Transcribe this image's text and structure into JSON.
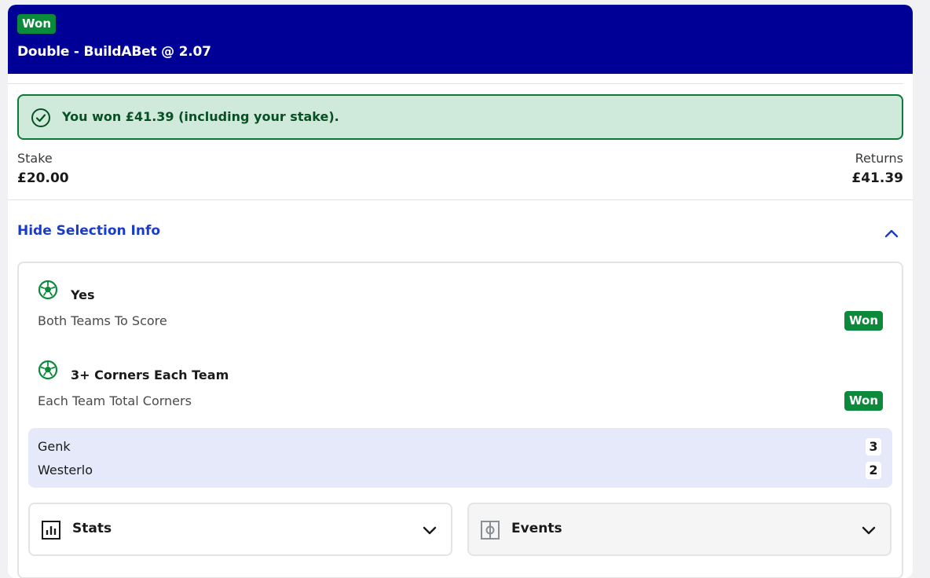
{
  "header": {
    "status_badge": "Won",
    "bet_title": "Double - BuildABet @ 2.07",
    "bg_color": "#000096"
  },
  "win_banner": {
    "icon": "check-circle-icon",
    "text": "You won £41.39 (including your stake)."
  },
  "summary": {
    "stake_label": "Stake",
    "stake_value": "£20.00",
    "returns_label": "Returns",
    "returns_value": "£41.39"
  },
  "selection_toggle": {
    "label": "Hide Selection Info",
    "icon": "chevron-up-icon"
  },
  "selections": [
    {
      "icon": "football-icon",
      "name": "Yes",
      "market": "Both Teams To Score",
      "status": "Won"
    },
    {
      "icon": "football-icon",
      "name": "3+ Corners Each Team",
      "market": "Each Team Total Corners",
      "status": "Won"
    }
  ],
  "scores": [
    {
      "team": "Genk",
      "value": "3"
    },
    {
      "team": "Westerlo",
      "value": "2"
    }
  ],
  "dropdowns": {
    "stats": {
      "label": "Stats",
      "icon": "bar-chart-icon"
    },
    "events": {
      "label": "Events",
      "icon": "pitch-icon"
    }
  },
  "colors": {
    "won_green": "#0a8a3a",
    "link_blue": "#1a3cc8",
    "banner_bg": "#cfe9da"
  }
}
